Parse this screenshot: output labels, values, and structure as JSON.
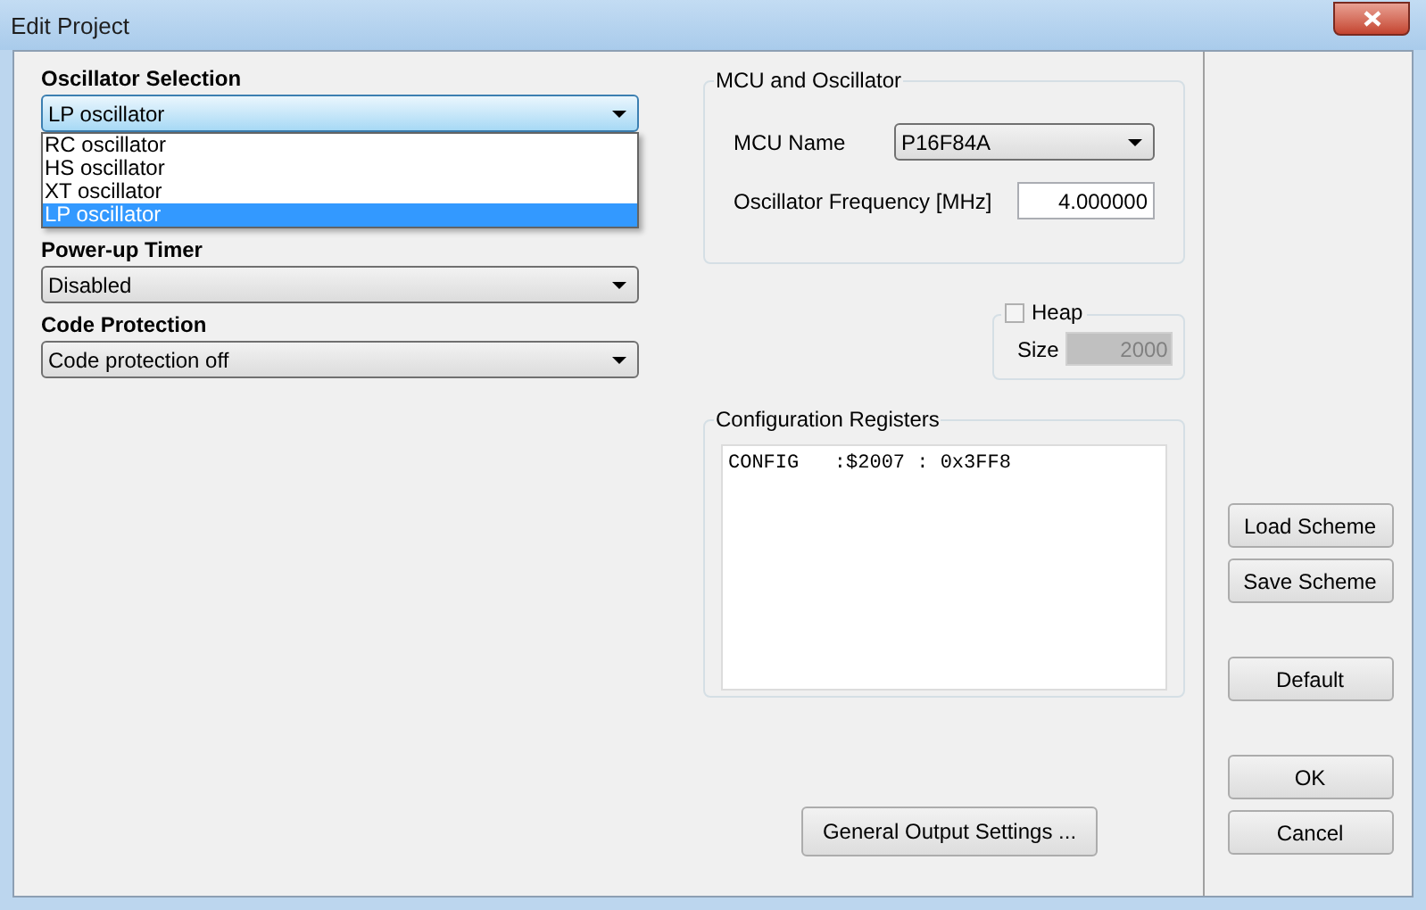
{
  "window": {
    "title": "Edit Project"
  },
  "left": {
    "fields": [
      {
        "label": "Oscillator Selection",
        "value": "LP oscillator",
        "expanded": true,
        "options": [
          {
            "label": "RC oscillator",
            "selected": false
          },
          {
            "label": "HS oscillator",
            "selected": false
          },
          {
            "label": "XT oscillator",
            "selected": false
          },
          {
            "label": "LP oscillator",
            "selected": true
          }
        ]
      },
      {
        "label": "Power-up Timer",
        "value": "Disabled",
        "expanded": false
      },
      {
        "label": "Code Protection",
        "value": "Code protection off",
        "expanded": false
      }
    ]
  },
  "mcu_group": {
    "title": "MCU and Oscillator",
    "mcu_label": "MCU Name",
    "mcu_value": "P16F84A",
    "freq_label": "Oscillator Frequency [MHz]",
    "freq_value": "4.000000"
  },
  "heap": {
    "label": "Heap",
    "checked": false,
    "size_label": "Size",
    "size_value": "2000"
  },
  "config": {
    "title": "Configuration Registers",
    "lines": [
      "CONFIG   :$2007 : 0x3FF8"
    ]
  },
  "general_button": "General Output Settings ...",
  "side_buttons": [
    {
      "label": "Load Scheme",
      "gap": false
    },
    {
      "label": "Save Scheme",
      "gap": false
    },
    {
      "label": "Default",
      "gap": true
    },
    {
      "label": "OK",
      "gap": true
    },
    {
      "label": "Cancel",
      "gap": false
    }
  ]
}
